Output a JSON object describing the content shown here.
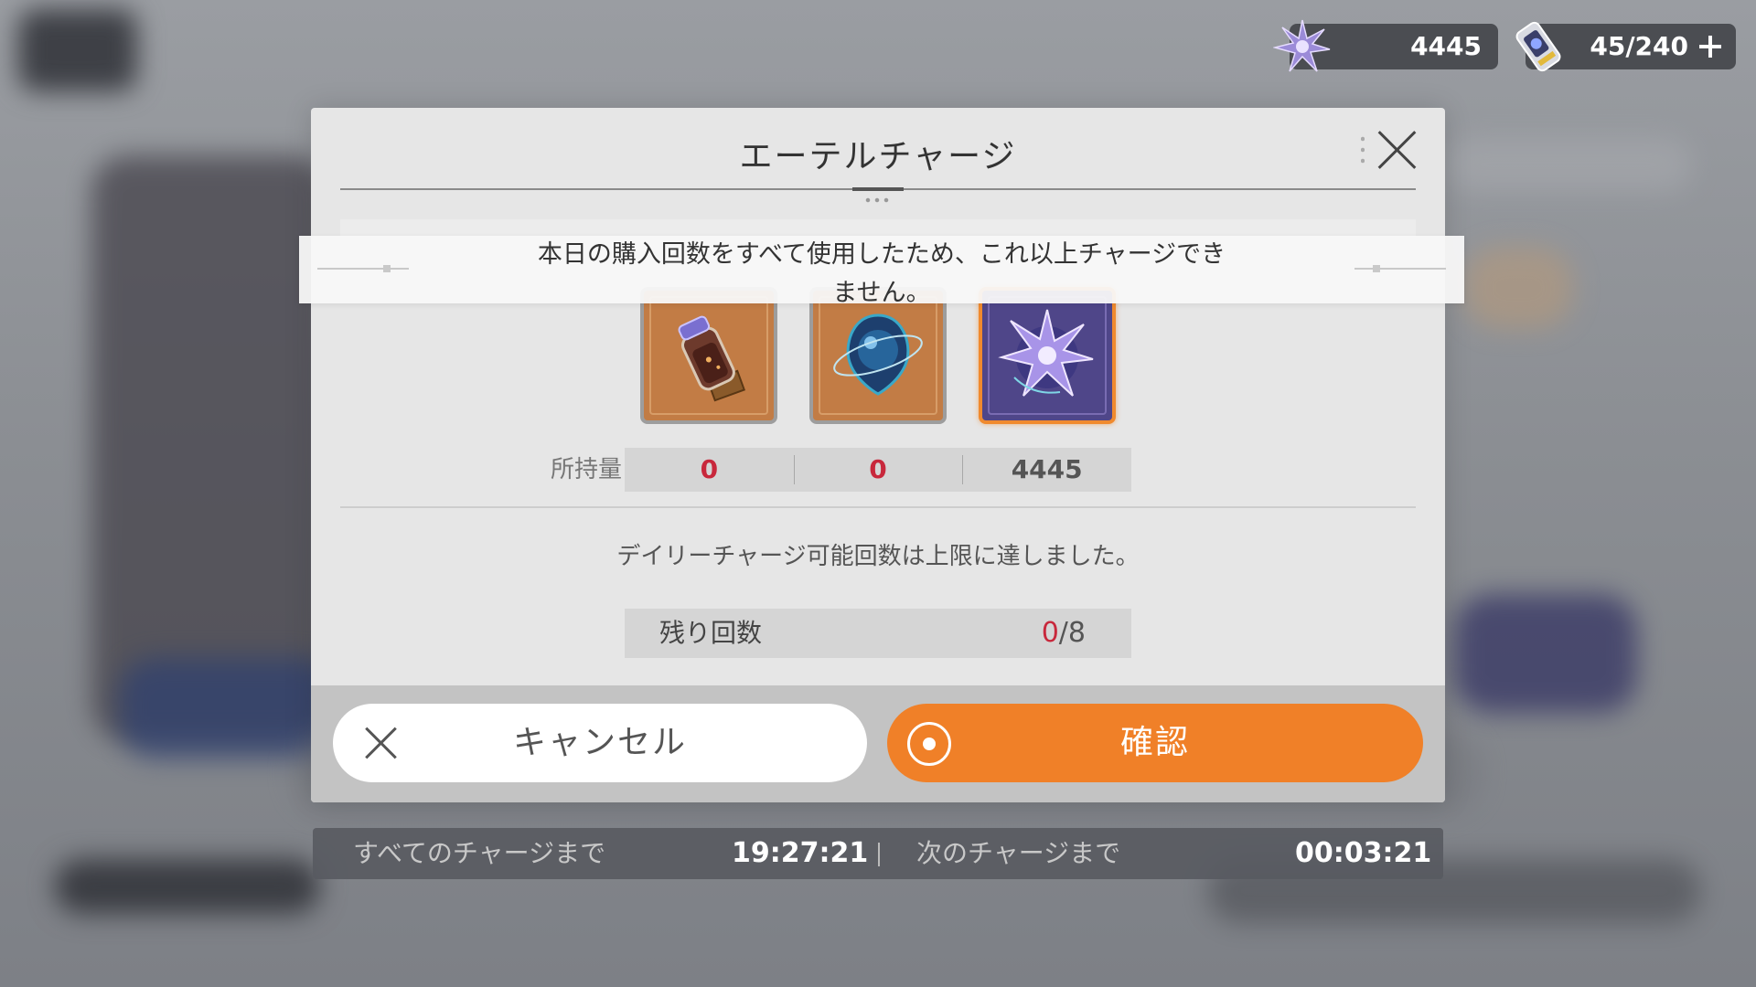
{
  "dialog": {
    "title": "エーテルチャージ",
    "owned_label": "所持量",
    "owned": [
      "0",
      "0",
      "4445"
    ],
    "notice": "デイリーチャージ可能回数は上限に達しました。",
    "remaining_label": "残り回数",
    "remaining_current": "0",
    "remaining_total": "/8",
    "items": [
      {
        "icon": "potion-bottle-icon"
      },
      {
        "icon": "orb-icon"
      },
      {
        "icon": "star-crystal-icon",
        "selected": true
      }
    ]
  },
  "toast": {
    "message": "本日の購入回数をすべて使用したため、これ以上チャージできません。"
  },
  "buttons": {
    "cancel": "キャンセル",
    "confirm": "確認"
  },
  "currency": {
    "crystal": "4445",
    "stamina": "45/240"
  },
  "timers": {
    "all_label": "すべてのチャージまで",
    "all_value": "19:27:21",
    "next_label": "次のチャージまで",
    "next_value": "00:03:21"
  },
  "colors": {
    "accent": "#f08028",
    "alert_red": "#c8283c",
    "selected_border": "#f08a2e"
  }
}
